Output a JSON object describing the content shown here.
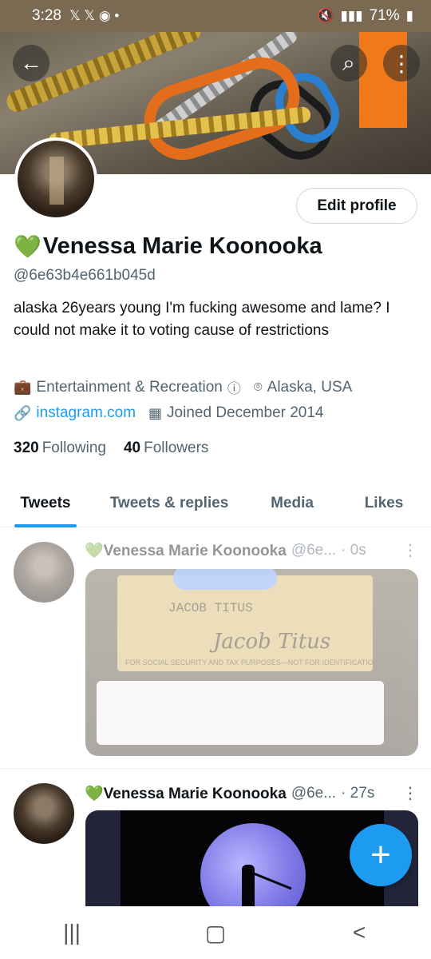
{
  "status_bar": {
    "time": "3:28",
    "notification_icons": "🐦🐦●•",
    "battery_percent": "71%"
  },
  "header": {
    "back_icon": "back-arrow-icon",
    "search_icon": "search-icon",
    "more_icon": "more-vertical-icon"
  },
  "profile": {
    "edit_label": "Edit profile",
    "name_emoji": "💚",
    "name": "Venessa Marie Koonooka",
    "handle": "@6e63b4e661b045d",
    "bio": "alaska 26years young I'm fucking awesome and lame? I could not make it to voting cause of restrictions",
    "category": "Entertainment & Recreation",
    "location": "Alaska, USA",
    "website": "instagram.com",
    "joined": "Joined December 2014",
    "following_count": "320",
    "following_label": "Following",
    "followers_count": "40",
    "followers_label": "Followers"
  },
  "tabs": [
    {
      "label": "Tweets",
      "active": true
    },
    {
      "label": "Tweets & replies",
      "active": false
    },
    {
      "label": "Media",
      "active": false
    },
    {
      "label": "Likes",
      "active": false
    }
  ],
  "tweets": [
    {
      "name": "💚Venessa Marie Koonooka",
      "handle": "@6e...",
      "time": "· 0s",
      "media_text_name": "JACOB TITUS",
      "media_text_signature": "Jacob Titus",
      "media_text_line": "FOR SOCIAL SECURITY AND TAX PURPOSES—NOT FOR IDENTIFICATION"
    },
    {
      "name": "💚Venessa Marie Koonooka",
      "handle": "@6e...",
      "time": "· 27s"
    }
  ],
  "fab_label": "+",
  "nav_bar": {
    "recents": "|||",
    "home": "▢",
    "back": "<"
  },
  "colors": {
    "accent": "#1d9bf0",
    "text_primary": "#0f1419",
    "text_secondary": "#536471",
    "status_bar": "#7a6a52"
  }
}
